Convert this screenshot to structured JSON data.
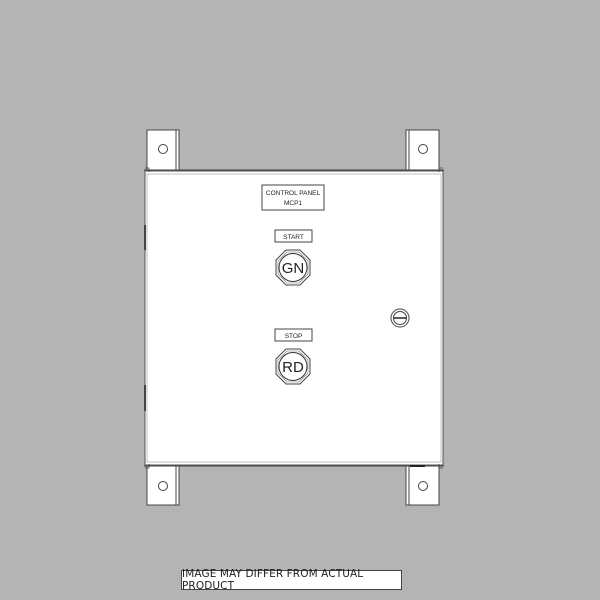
{
  "nameplate": {
    "line1": "CONTROL PANEL",
    "line2": "MCP1"
  },
  "buttons": [
    {
      "label": "START",
      "color_code": "GN"
    },
    {
      "label": "STOP",
      "color_code": "RD"
    }
  ],
  "disclaimer": "IMAGE MAY DIFFER FROM ACTUAL PRODUCT",
  "colors": {
    "background": "#b3b4b3",
    "enclosure": "#ffffff",
    "line": "#444444"
  }
}
